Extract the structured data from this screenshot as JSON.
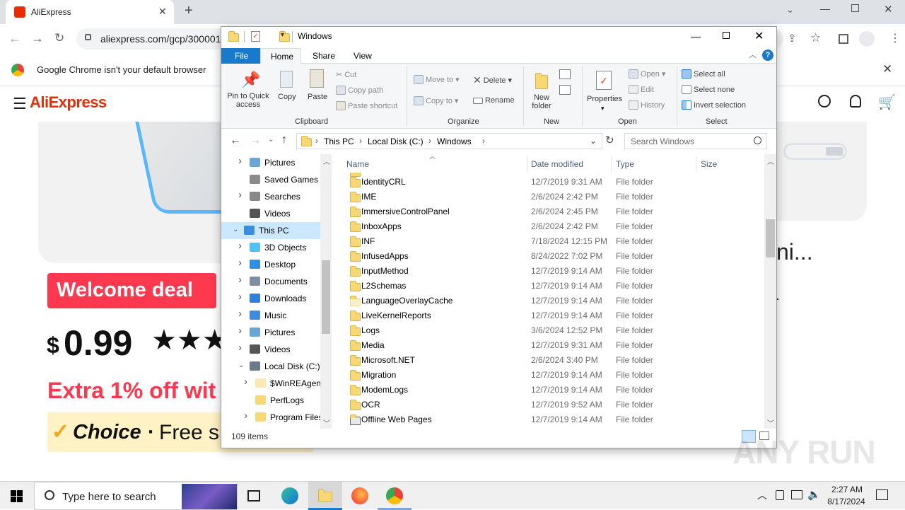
{
  "browser": {
    "tab_title": "AliExpress",
    "url": "aliexpress.com/gcp/3000015",
    "infobar_text": "Google Chrome isn't your default browser"
  },
  "ae": {
    "logo": "AliExpress",
    "welcome_badge": "Welcome deal",
    "price_currency": "$",
    "price": "0.99",
    "stars": "★★★",
    "extra_off": "Extra 1% off wit",
    "choice_brand": "Choice",
    "choice_dot": "·",
    "choice_text": "Free s",
    "title_right": "ni...",
    "colors": {
      "red": "#e62e04",
      "pink": "#fd384f",
      "choice_bg": "#fff3c6"
    }
  },
  "explorer": {
    "title": "Windows",
    "ribbon_tabs": [
      "File",
      "Home",
      "Share",
      "View"
    ],
    "clipboard": {
      "pin": "Pin to Quick access",
      "copy": "Copy",
      "paste": "Paste",
      "cut": "Cut",
      "copy_path": "Copy path",
      "paste_shortcut": "Paste shortcut",
      "group": "Clipboard"
    },
    "organize": {
      "move_to": "Move to",
      "copy_to": "Copy to",
      "delete": "Delete",
      "rename": "Rename",
      "group": "Organize"
    },
    "new": {
      "new_folder": "New folder",
      "group": "New"
    },
    "open": {
      "properties": "Properties",
      "open": "Open",
      "edit": "Edit",
      "history": "History",
      "group": "Open"
    },
    "select": {
      "select_all": "Select all",
      "select_none": "Select none",
      "invert": "Invert selection",
      "group": "Select"
    },
    "breadcrumb": [
      "This PC",
      "Local Disk (C:)",
      "Windows"
    ],
    "search_placeholder": "Search Windows",
    "columns": {
      "name": "Name",
      "date": "Date modified",
      "type": "Type",
      "size": "Size"
    },
    "nav": [
      {
        "label": "Pictures",
        "indent": 1,
        "icon": "pictures",
        "arrow": "right"
      },
      {
        "label": "Saved Games",
        "indent": 1,
        "icon": "games",
        "arrow": ""
      },
      {
        "label": "Searches",
        "indent": 1,
        "icon": "search",
        "arrow": "right"
      },
      {
        "label": "Videos",
        "indent": 1,
        "icon": "videos",
        "arrow": ""
      },
      {
        "label": "This PC",
        "indent": 0,
        "icon": "pc",
        "arrow": "down",
        "selected": true
      },
      {
        "label": "3D Objects",
        "indent": 1,
        "icon": "3d",
        "arrow": "right"
      },
      {
        "label": "Desktop",
        "indent": 1,
        "icon": "desktop",
        "arrow": "right"
      },
      {
        "label": "Documents",
        "indent": 1,
        "icon": "documents",
        "arrow": "right"
      },
      {
        "label": "Downloads",
        "indent": 1,
        "icon": "downloads",
        "arrow": "right"
      },
      {
        "label": "Music",
        "indent": 1,
        "icon": "music",
        "arrow": "right"
      },
      {
        "label": "Pictures",
        "indent": 1,
        "icon": "pictures",
        "arrow": "right"
      },
      {
        "label": "Videos",
        "indent": 1,
        "icon": "videos",
        "arrow": "right"
      },
      {
        "label": "Local Disk (C:)",
        "indent": 1,
        "icon": "disk",
        "arrow": "down"
      },
      {
        "label": "$WinREAgent",
        "indent": 2,
        "icon": "folder-faded",
        "arrow": "right"
      },
      {
        "label": "PerfLogs",
        "indent": 2,
        "icon": "folder",
        "arrow": ""
      },
      {
        "label": "Program Files",
        "indent": 2,
        "icon": "folder",
        "arrow": "right"
      }
    ],
    "files": [
      {
        "name": "IdentityCRL",
        "date": "12/7/2019 9:31 AM",
        "type": "File folder"
      },
      {
        "name": "IME",
        "date": "2/6/2024 2:42 PM",
        "type": "File folder"
      },
      {
        "name": "ImmersiveControlPanel",
        "date": "2/6/2024 2:45 PM",
        "type": "File folder"
      },
      {
        "name": "InboxApps",
        "date": "2/6/2024 2:42 PM",
        "type": "File folder"
      },
      {
        "name": "INF",
        "date": "7/18/2024 12:15 PM",
        "type": "File folder"
      },
      {
        "name": "InfusedApps",
        "date": "8/24/2022 7:02 PM",
        "type": "File folder"
      },
      {
        "name": "InputMethod",
        "date": "12/7/2019 9:14 AM",
        "type": "File folder"
      },
      {
        "name": "L2Schemas",
        "date": "12/7/2019 9:14 AM",
        "type": "File folder"
      },
      {
        "name": "LanguageOverlayCache",
        "date": "12/7/2019 9:14 AM",
        "type": "File folder",
        "faded": true
      },
      {
        "name": "LiveKernelReports",
        "date": "12/7/2019 9:14 AM",
        "type": "File folder"
      },
      {
        "name": "Logs",
        "date": "3/6/2024 12:52 PM",
        "type": "File folder"
      },
      {
        "name": "Media",
        "date": "12/7/2019 9:31 AM",
        "type": "File folder"
      },
      {
        "name": "Microsoft.NET",
        "date": "2/6/2024 3:40 PM",
        "type": "File folder"
      },
      {
        "name": "Migration",
        "date": "12/7/2019 9:14 AM",
        "type": "File folder"
      },
      {
        "name": "ModemLogs",
        "date": "12/7/2019 9:14 AM",
        "type": "File folder"
      },
      {
        "name": "OCR",
        "date": "12/7/2019 9:52 AM",
        "type": "File folder"
      },
      {
        "name": "Offline Web Pages",
        "date": "12/7/2019 9:14 AM",
        "type": "File folder",
        "special": true
      }
    ],
    "status": "109 items"
  },
  "taskbar": {
    "search_placeholder": "Type here to search",
    "time": "2:27 AM",
    "date": "8/17/2024"
  },
  "watermark": "ANY RUN"
}
